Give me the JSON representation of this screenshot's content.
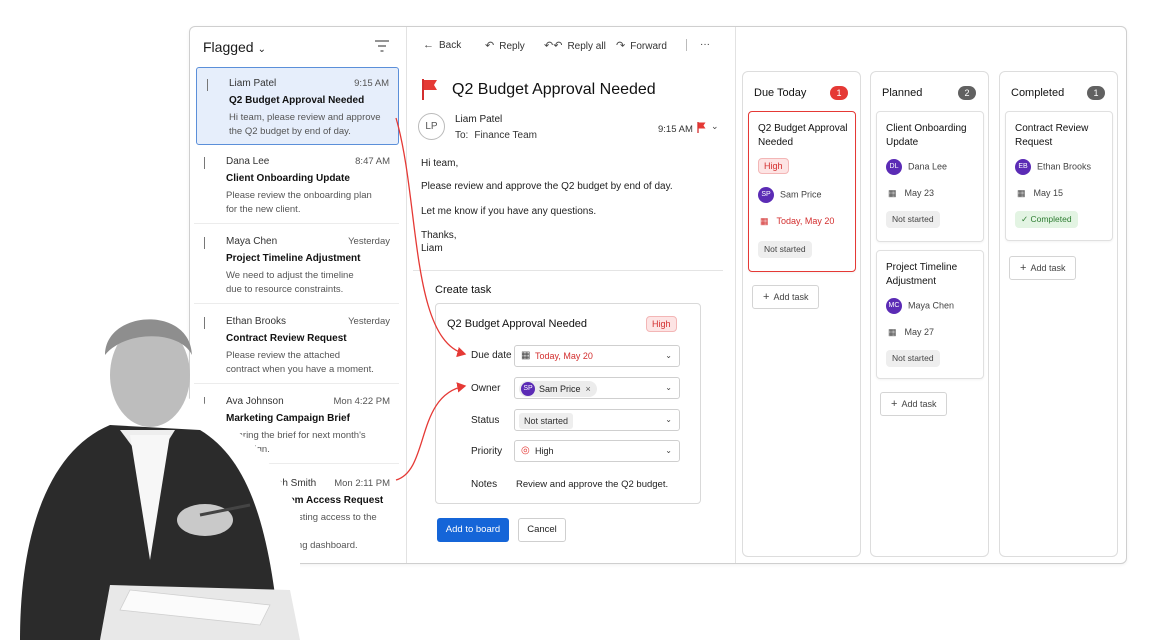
{
  "list": {
    "title": "Flagged",
    "items": [
      {
        "from": "Liam Patel",
        "time": "9:15 AM",
        "subject": "Q2 Budget Approval Needed",
        "preview1": "Hi team, please review and approve",
        "preview2": "the Q2 budget by end of day."
      },
      {
        "from": "Dana Lee",
        "time": "8:47 AM",
        "subject": "Client Onboarding Update",
        "preview1": "Please review the onboarding plan",
        "preview2": "for the new client."
      },
      {
        "from": "Maya Chen",
        "time": "Yesterday",
        "subject": "Project Timeline Adjustment",
        "preview1": "We need to adjust the timeline",
        "preview2": "due to resource constraints."
      },
      {
        "from": "Ethan Brooks",
        "time": "Yesterday",
        "subject": "Contract Review Request",
        "preview1": "Please review the attached",
        "preview2": "contract when you have a moment."
      },
      {
        "from": "Ava Johnson",
        "time": "Mon 4:22 PM",
        "subject": "Marketing Campaign Brief",
        "preview1": "Sharing the brief for next month's",
        "preview2": "campaign."
      },
      {
        "from": "Noah Smith",
        "time": "Mon 2:11 PM",
        "subject": "System Access Request",
        "preview1": "Requesting access to the new",
        "preview2": "reporting dashboard."
      }
    ]
  },
  "toolbar": {
    "back": "Back",
    "reply": "Reply",
    "reply_all": "Reply all",
    "forward": "Forward",
    "more": "···"
  },
  "message": {
    "subject": "Q2 Budget Approval Needed",
    "avatar": "LP",
    "from": "Liam Patel",
    "to_label": "To:",
    "to": "Finance Team",
    "time": "9:15 AM",
    "greeting": "Hi team,",
    "line1": "Please review and approve the Q2 budget by end of day.",
    "line2": "Let me know if you have any questions.",
    "signoff": "Thanks,",
    "signature": "Liam"
  },
  "create_task": {
    "title": "Create task",
    "task_name": "Q2 Budget Approval Needed",
    "priority_pill": "High",
    "fields": {
      "due_label": "Due date",
      "due_value": "Today, May 20",
      "owner_label": "Owner",
      "owner_initials": "SP",
      "owner_value": "Sam Price",
      "status_label": "Status",
      "status_value": "Not started",
      "priority_label": "Priority",
      "priority_value": "High",
      "notes_label": "Notes",
      "notes_value": "Review and approve the Q2 budget."
    },
    "add_button": "Add to board",
    "cancel_button": "Cancel"
  },
  "board": {
    "columns": [
      {
        "title": "Due Today",
        "count": "1",
        "count_color": "#e53935",
        "cards": [
          {
            "title": "Q2 Budget Approval Needed",
            "pill": "High",
            "initials": "SP",
            "person": "Sam Price",
            "date": "Today, May 20",
            "status": "Not started"
          }
        ],
        "add": "Add task"
      },
      {
        "title": "Planned",
        "count": "2",
        "count_color": "#616161",
        "cards": [
          {
            "title": "Client Onboarding Update",
            "initials": "DL",
            "person": "Dana Lee",
            "date": "May 23",
            "status": "Not started"
          },
          {
            "title": "Project Timeline Adjustment",
            "initials": "MC",
            "person": "Maya Chen",
            "date": "May 27",
            "status": "Not started"
          }
        ],
        "add": "Add task"
      },
      {
        "title": "Completed",
        "count": "1",
        "count_color": "#616161",
        "cards": [
          {
            "title": "Contract Review Request",
            "initials": "EB",
            "person": "Ethan Brooks",
            "date": "May 15",
            "status": "Completed"
          }
        ],
        "add": "Add task"
      }
    ]
  },
  "icons": {
    "flag": "flag-icon",
    "calendar": "calendar-icon",
    "filter": "filter-icon",
    "plus": "plus-icon"
  },
  "colors": {
    "accent": "#1565d8",
    "alert": "#e53935",
    "avatar": "#5b2bb5",
    "selected_bg": "#e6eefb"
  }
}
